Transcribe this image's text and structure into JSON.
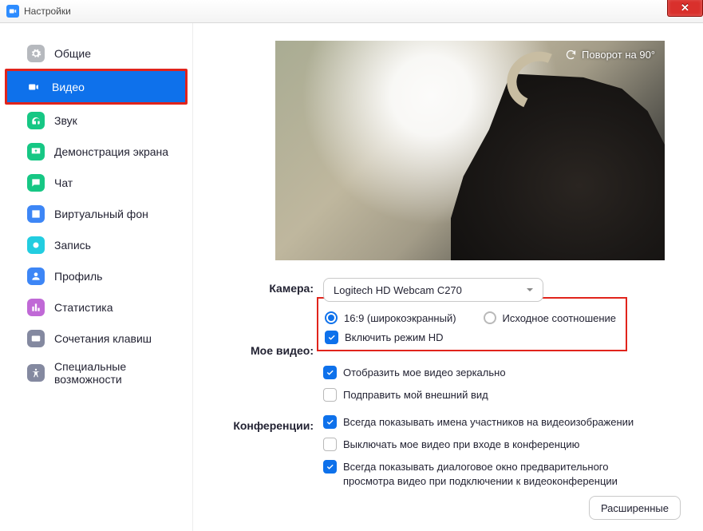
{
  "window": {
    "title": "Настройки"
  },
  "sidebar": {
    "items": [
      {
        "label": "Общие",
        "icon": "gear",
        "color": "#b6b9be"
      },
      {
        "label": "Видео",
        "icon": "video",
        "color": "#ffffff",
        "active": true
      },
      {
        "label": "Звук",
        "icon": "headphones",
        "color": "#16c784"
      },
      {
        "label": "Демонстрация экрана",
        "icon": "share",
        "color": "#16c784"
      },
      {
        "label": "Чат",
        "icon": "chat",
        "color": "#16c784"
      },
      {
        "label": "Виртуальный фон",
        "icon": "bg",
        "color": "#3d86f6"
      },
      {
        "label": "Запись",
        "icon": "record",
        "color": "#22cde0"
      },
      {
        "label": "Профиль",
        "icon": "profile",
        "color": "#3d86f6"
      },
      {
        "label": "Статистика",
        "icon": "stats",
        "color": "#c069d6"
      },
      {
        "label": "Сочетания клавиш",
        "icon": "keyboard",
        "color": "#8489a0"
      },
      {
        "label": "Специальные возможности",
        "icon": "a11y",
        "color": "#8489a0"
      }
    ]
  },
  "preview": {
    "rotate_label": "Поворот на 90°"
  },
  "form": {
    "camera_label": "Камера:",
    "camera_value": "Logitech HD Webcam C270",
    "aspect_16_9": "16:9 (широкоэкранный)",
    "aspect_original": "Исходное соотношение",
    "myvideo_label": "Мое видео:",
    "hd": "Включить режим HD",
    "mirror": "Отобразить мое видео зеркально",
    "touchup": "Подправить мой внешний вид",
    "meetings_label": "Конференции:",
    "show_names": "Всегда показывать имена участников на видеоизображении",
    "mute_video": "Выключать мое видео при входе в конференцию",
    "preview_dialog": "Всегда показывать диалоговое окно предварительного просмотра видео при подключении к видеоконференции",
    "advanced": "Расширенные"
  }
}
